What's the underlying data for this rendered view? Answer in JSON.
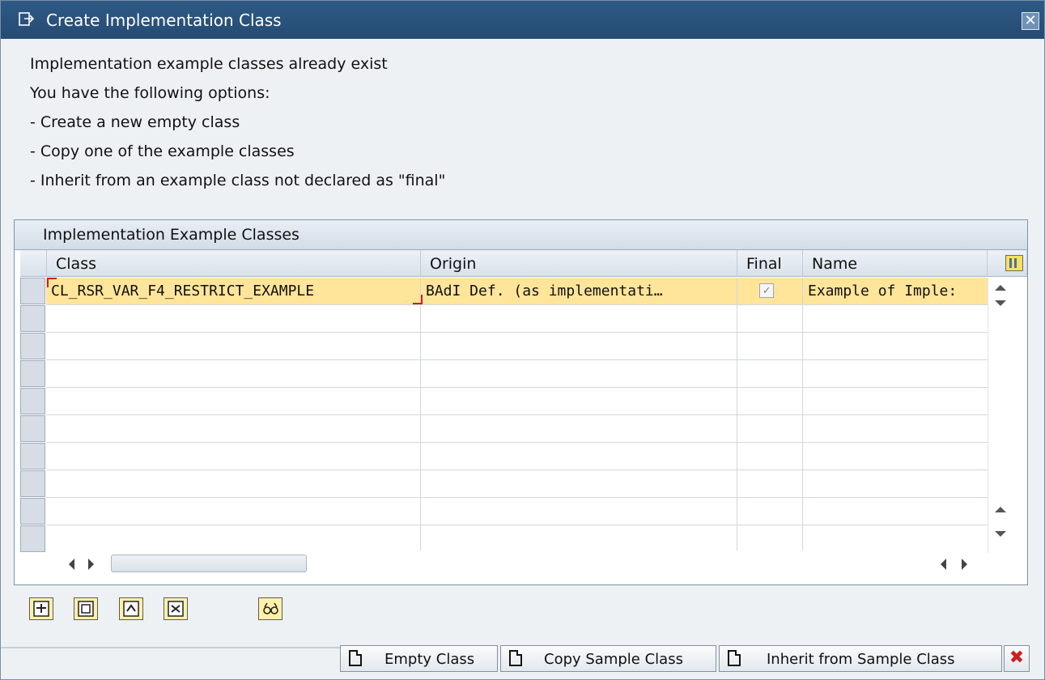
{
  "window": {
    "title": "Create Implementation Class",
    "close_icon": "close-icon"
  },
  "messages": [
    "Implementation example classes already exist",
    "You have the following options:",
    "- Create a new empty class",
    "- Copy one of the example classes",
    "- Inherit from an example class not declared as \"final\""
  ],
  "grid": {
    "title": "Implementation Example Classes",
    "columns": [
      "Class",
      "Origin",
      "Final",
      "Name"
    ],
    "rows": [
      {
        "class": "CL_RSR_VAR_F4_RESTRICT_EXAMPLE",
        "origin": "BAdI Def. (as implementati…",
        "final": true,
        "name": "Example of Imple:"
      }
    ]
  },
  "toolbar": {
    "icons": [
      "insert-row-icon",
      "copy-row-icon",
      "paste-row-icon",
      "delete-row-icon",
      "display-icon"
    ]
  },
  "buttons": {
    "empty": "Empty Class",
    "copy": "Copy Sample Class",
    "inherit": "Inherit from Sample Class",
    "cancel_icon": "cancel-icon"
  },
  "colors": {
    "title_bar": "#2e5a86",
    "selected_row": "#ffe59a",
    "focus": "#d31b1b",
    "cancel": "#cc1f1f"
  }
}
